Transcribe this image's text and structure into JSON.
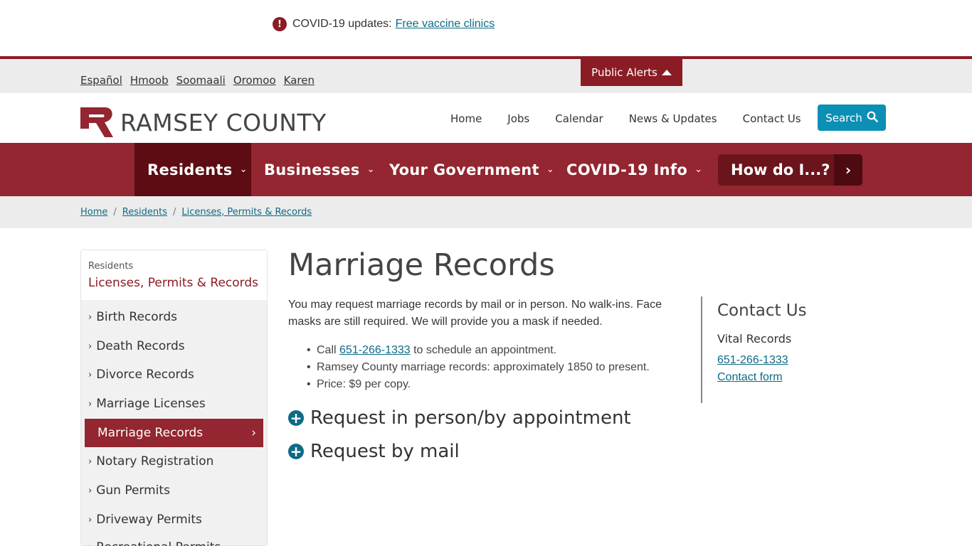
{
  "alert": {
    "icon": "exclamation-icon",
    "prefix": "COVID-19 updates:",
    "link": "Free vaccine clinics"
  },
  "languages": [
    "Español",
    "Hmoob",
    "Soomaali",
    "Oromoo",
    "Karen"
  ],
  "public_alerts": "Public Alerts",
  "header": {
    "logo_text": "RAMSEY COUNTY",
    "util_nav": [
      "Home",
      "Jobs",
      "Calendar",
      "News & Updates",
      "Contact Us"
    ],
    "search_label": "Search"
  },
  "main_nav": {
    "items": [
      "Residents",
      "Businesses",
      "Your Government",
      "COVID-19 Info"
    ],
    "active": "Residents",
    "howdo": "How do I...?"
  },
  "breadcrumb": [
    "Home",
    "Residents",
    "Licenses, Permits & Records"
  ],
  "sidebar": {
    "parent": "Residents",
    "title": "Licenses, Permits & Records",
    "items": [
      "Birth Records",
      "Death Records",
      "Divorce Records",
      "Marriage Licenses",
      "Marriage Records",
      "Notary Registration",
      "Gun Permits",
      "Driveway Permits",
      "Recreational Permits"
    ],
    "active": "Marriage Records"
  },
  "content": {
    "title": "Marriage Records",
    "intro": "You may request marriage records by mail or in person. No walk-ins. Face masks are still required. We will provide you a mask if needed.",
    "bullet1_prefix": "Call",
    "bullet1_phone": "651-266-1333",
    "bullet1_suffix": "to schedule an appointment.",
    "bullet2": "Ramsey County marriage records: approximately 1850 to present.",
    "bullet3": "Price: $9 per copy.",
    "accordion1": "Request in person/by appointment",
    "accordion2": "Request by mail"
  },
  "contact": {
    "title": "Contact Us",
    "org": "Vital Records",
    "phone": "651-266-1333",
    "form": "Contact form"
  },
  "colors": {
    "brand_red": "#932630",
    "active_red": "#5c0c12",
    "link_teal": "#0d6b86",
    "search_blue": "#0b8fb5"
  }
}
